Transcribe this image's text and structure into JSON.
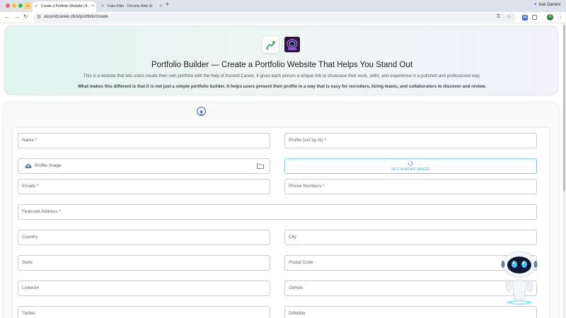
{
  "browser": {
    "tabs": [
      {
        "title": "Create a Portfolio Website | A",
        "active": true
      },
      {
        "title": "Fake Filler - Chrome Web St",
        "active": false
      }
    ],
    "new_tab": "+",
    "gemini_label": "Ask Gemini",
    "url": "ascendcareer.click/portfolio/create",
    "profile_initial": "A"
  },
  "hero": {
    "title": "Portfolio Builder — Create a Portfolio Website That Helps You Stand Out",
    "description": "This is a website that lets users create their own portfolio with the help of Ascend Career. It gives each person a unique link to showcase their work, skills, and experience in a polished and professional way.",
    "subtitle": "What makes this different is that it is not just a simple portfolio builder. It helps users present their profile in a way that is easy for recruiters, hiring teams, and collaborators to discover and review."
  },
  "form": {
    "name": "Name *",
    "profile": "Profile (set by AI) *",
    "profile_image": "Profile Image",
    "set_avatar": "SET AVATAR IMAGE",
    "emails": "Emails *",
    "phone": "Phone Numbers *",
    "featured_address": "Featured Address *",
    "country": "Country",
    "city": "City",
    "state": "State",
    "postal_code": "Postal Code",
    "linkedin": "LinkedIn",
    "github": "GitHub",
    "twitter": "Twitter",
    "dribbble": "Dribbble"
  },
  "colors": {
    "accent": "#4aa7d8",
    "step_icon": "#3d5bd0"
  }
}
